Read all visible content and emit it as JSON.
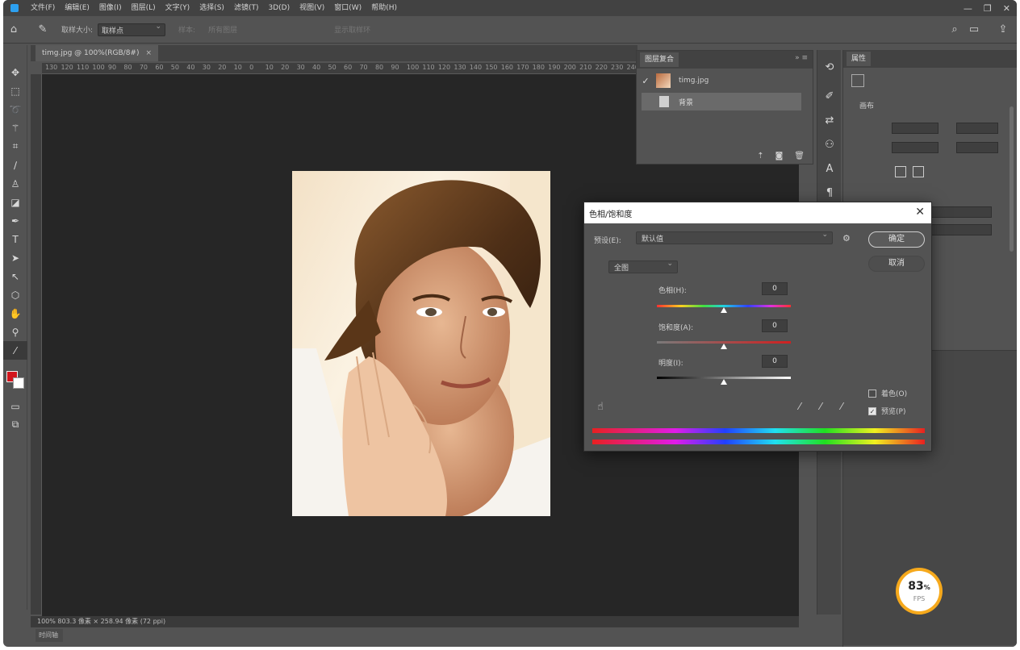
{
  "menubar": {
    "items": [
      "文件(F)",
      "编辑(E)",
      "图像(I)",
      "图层(L)",
      "文字(Y)",
      "选择(S)",
      "滤镜(T)",
      "3D(D)",
      "视图(V)",
      "窗口(W)",
      "帮助(H)"
    ],
    "window_controls": [
      "—",
      "❐",
      "✕"
    ]
  },
  "optionsbar": {
    "sample_size_label": "取样大小:",
    "sample_size_value": "取样点",
    "sample_label": "样本:",
    "sample_value": "所有图层",
    "show_ring_label": "显示取样环"
  },
  "document": {
    "tab_title": "timg.jpg @ 100%(RGB/8#)",
    "ruler_ticks": [
      "130",
      "120",
      "110",
      "100",
      "90",
      "80",
      "70",
      "60",
      "50",
      "40",
      "30",
      "20",
      "10",
      "0",
      "10",
      "20",
      "30",
      "40",
      "50",
      "60",
      "70",
      "80",
      "90",
      "100",
      "110",
      "120",
      "130",
      "140",
      "150",
      "160",
      "170",
      "180",
      "190",
      "200",
      "210",
      "220",
      "230",
      "240"
    ],
    "status": "100%   803.3 像素 × 258.94 像素 (72 ppi)",
    "bottom_tab": "时间轴"
  },
  "layers": {
    "tab": "图层复合",
    "layer_name": "timg.jpg",
    "sub_item": "背景"
  },
  "properties": {
    "tab": "属性",
    "section": "画布"
  },
  "fps": {
    "percent": "83",
    "unit": "%",
    "label": "FPS"
  },
  "dialog": {
    "title": "色相/饱和度",
    "preset_label": "预设(E):",
    "preset_value": "默认值",
    "ok": "确定",
    "cancel": "取消",
    "channel": "全图",
    "hue_label": "色相(H):",
    "hue_value": "0",
    "saturation_label": "饱和度(A):",
    "saturation_value": "0",
    "lightness_label": "明度(I):",
    "lightness_value": "0",
    "colorize_label": "着色(O)",
    "preview_label": "预览(P)",
    "colorize_checked": false,
    "preview_checked": true
  },
  "colors": {
    "foreground": "#d2161d",
    "background": "#ffffff",
    "accent": "#2da0f0",
    "fps_ring": "#f6a91c"
  }
}
